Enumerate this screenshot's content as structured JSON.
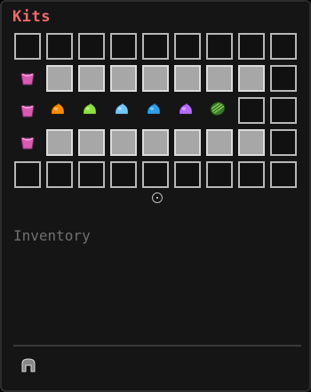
{
  "title": "Kits",
  "inventory_label": "Inventory",
  "rows": [
    {
      "side": null,
      "slots": [
        "empty",
        "empty",
        "empty",
        "empty",
        "empty",
        "empty",
        "empty",
        "empty",
        "empty"
      ]
    },
    {
      "side": "pink-pot-icon",
      "slots": [
        "empty",
        "filler",
        "filler",
        "filler",
        "filler",
        "filler",
        "filler",
        "filler",
        "empty"
      ]
    },
    {
      "side": "pink-pot-icon",
      "slots": [
        "empty",
        "orange-slime-icon",
        "green-slime-icon",
        "lightblue-slime-icon",
        "blue-slime-icon",
        "purple-slime-icon",
        "watermelon-icon",
        "empty",
        "empty"
      ]
    },
    {
      "side": "pink-pot-icon",
      "slots": [
        "empty",
        "filler",
        "filler",
        "filler",
        "filler",
        "filler",
        "filler",
        "filler",
        "empty"
      ]
    },
    {
      "side": null,
      "slots": [
        "empty",
        "empty",
        "empty",
        "empty",
        "empty",
        "empty",
        "empty",
        "empty",
        "empty"
      ]
    }
  ],
  "icon_colors": {
    "orange-slime-icon": "#ff8a00",
    "green-slime-icon": "#8ee23f",
    "lightblue-slime-icon": "#74c6ff",
    "blue-slime-icon": "#2e9fe6",
    "purple-slime-icon": "#b56cff",
    "watermelon-icon": "#3a7d2a",
    "pink-pot-icon": "#d85bb2"
  },
  "bottom_icon": "helmet-icon"
}
